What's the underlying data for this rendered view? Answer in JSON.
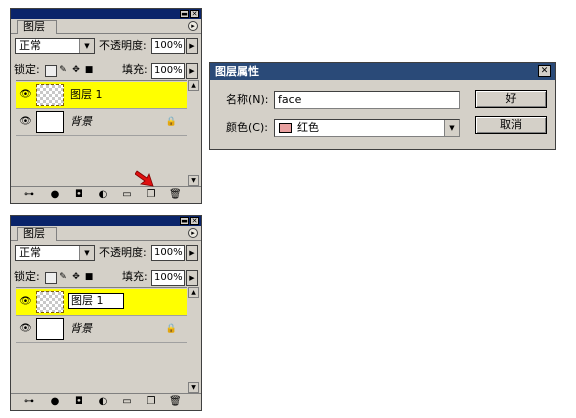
{
  "palette_top": {
    "tab_label": "图层",
    "blend_mode": "正常",
    "opacity_label": "不透明度:",
    "opacity_value": "100%",
    "lock_label": "锁定:",
    "fill_label": "填充:",
    "fill_value": "100%",
    "layers": [
      {
        "name": "图层 1",
        "selected": true,
        "highlight_color": "#ffff00"
      },
      {
        "name": "背景",
        "selected": false
      }
    ]
  },
  "palette_bottom": {
    "tab_label": "图层",
    "blend_mode": "正常",
    "opacity_label": "不透明度:",
    "opacity_value": "100%",
    "lock_label": "锁定:",
    "fill_label": "填充:",
    "fill_value": "100%",
    "layers": [
      {
        "name": "图层 1",
        "selected": true,
        "editing": true,
        "highlight_color": "#ffff00"
      },
      {
        "name": "背景",
        "selected": false
      }
    ]
  },
  "dialog": {
    "title": "图层属性",
    "name_label": "名称(N):",
    "name_value": "face",
    "color_label": "颜色(C):",
    "color_value": "红色",
    "color_swatch": "#e8a0a0",
    "ok_label": "好",
    "cancel_label": "取消",
    "titlebar_color": "#2a4a78"
  },
  "icons": [
    "minimize-icon",
    "close-icon",
    "palette-menu-icon",
    "dropdown-arrow-icon",
    "lock-transparency-icon",
    "lock-paint-icon",
    "lock-move-icon",
    "lock-all-icon",
    "eye-icon",
    "lock-icon",
    "link-icon",
    "fx-icon",
    "mask-icon",
    "adjustment-icon",
    "folder-icon",
    "new-layer-icon",
    "trash-icon",
    "red-pointer-arrow-icon"
  ]
}
